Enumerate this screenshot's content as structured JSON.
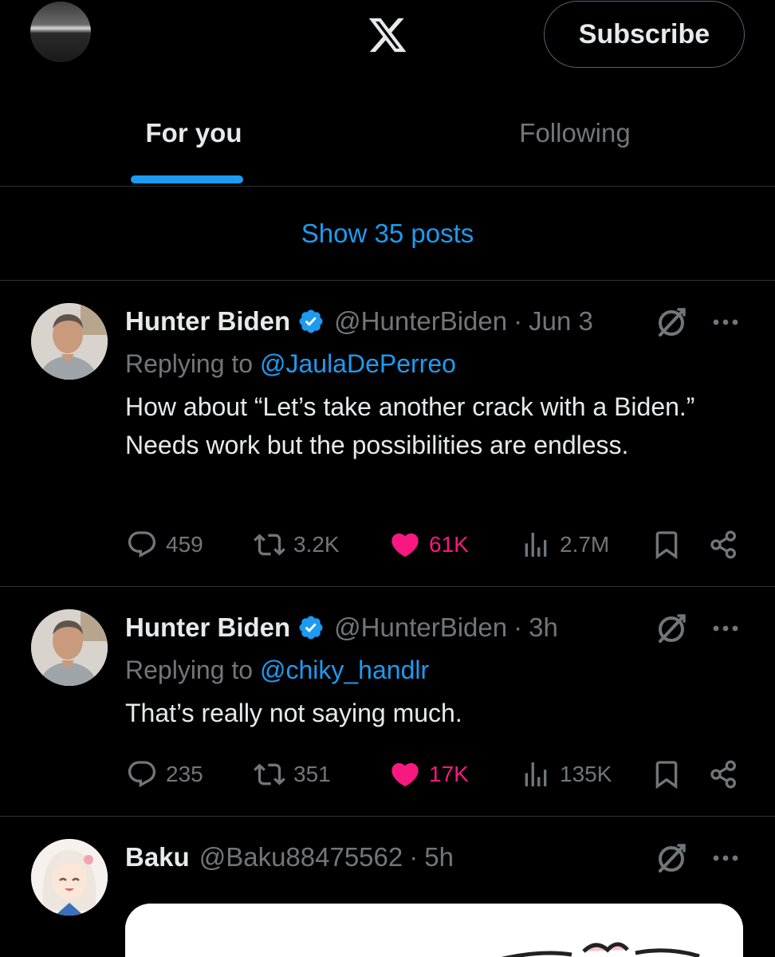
{
  "header": {
    "logo_icon": "x-logo-icon",
    "subscribe_label": "Subscribe"
  },
  "tabs": [
    {
      "label": "For you",
      "active": true
    },
    {
      "label": "Following",
      "active": false
    }
  ],
  "show_posts_label": "Show 35 posts",
  "colors": {
    "accent": "#1d9bf0",
    "like": "#f91880",
    "muted": "#71767b",
    "divider": "#2f3336",
    "text": "#e7e9ea"
  },
  "tweets": [
    {
      "name": "Hunter Biden",
      "verified": true,
      "handle": "@HunterBiden",
      "separator": "·",
      "time": "Jun 3",
      "replying_prefix": "Replying to ",
      "replying_to": "@JaulaDePerreo",
      "text": "How about “Let’s take another crack with a Biden.” Needs work but the possibilities are endless.",
      "replies": "459",
      "reposts": "3.2K",
      "likes": "61K",
      "views": "2.7M",
      "liked": true
    },
    {
      "name": "Hunter Biden",
      "verified": true,
      "handle": "@HunterBiden",
      "separator": "·",
      "time": "3h",
      "replying_prefix": "Replying to ",
      "replying_to": "@chiky_handlr",
      "text": "That’s really not saying much.",
      "replies": "235",
      "reposts": "351",
      "likes": "17K",
      "views": "135K",
      "liked": true
    },
    {
      "name": "Baku",
      "verified": false,
      "handle": "@Baku88475562",
      "separator": "·",
      "time": "5h"
    }
  ]
}
